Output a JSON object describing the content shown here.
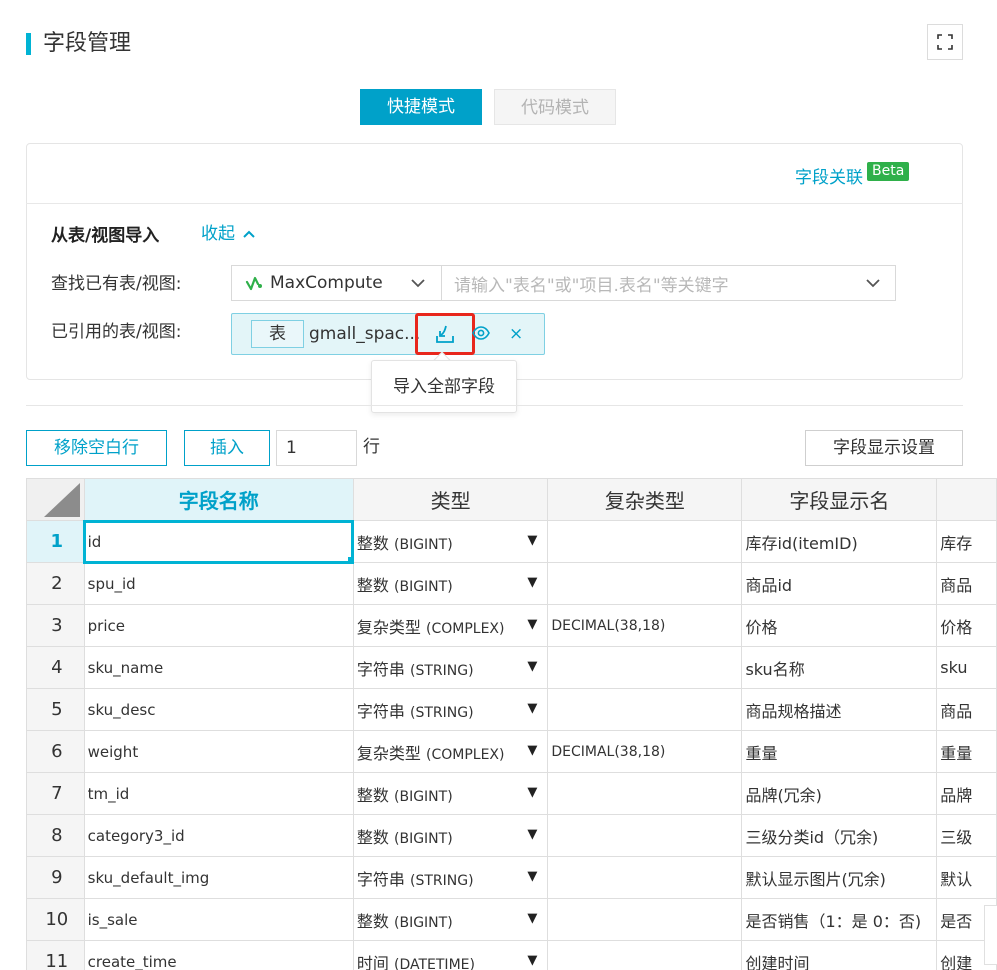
{
  "header": {
    "title": "字段管理"
  },
  "modes": {
    "quick": "快捷模式",
    "code": "代码模式"
  },
  "import_panel": {
    "relation_link": "字段关联",
    "beta": "Beta",
    "section_title": "从表/视图导入",
    "collapse_label": "收起",
    "find_label": "查找已有表/视图:",
    "source": "MaxCompute",
    "search_placeholder": "请输入\"表名\"或\"项目.表名\"等关键字",
    "ref_label": "已引用的表/视图:",
    "chip_tag": "表",
    "chip_name": "gmall_spac...",
    "chip_close": "×",
    "tooltip": "导入全部字段"
  },
  "toolbar": {
    "remove_blank": "移除空白行",
    "insert": "插入",
    "row_count": "1",
    "row_unit": "行",
    "display_settings": "字段显示设置"
  },
  "grid": {
    "columns": [
      "字段名称",
      "类型",
      "复杂类型",
      "字段显示名"
    ],
    "rows": [
      {
        "num": "1",
        "name": "id",
        "type_cn": "整数",
        "type_en": "(BIGINT)",
        "complex": "",
        "display": "库存id(itemID)",
        "extra": "库存"
      },
      {
        "num": "2",
        "name": "spu_id",
        "type_cn": "整数",
        "type_en": "(BIGINT)",
        "complex": "",
        "display": "商品id",
        "extra": "商品"
      },
      {
        "num": "3",
        "name": "price",
        "type_cn": "复杂类型",
        "type_en": "(COMPLEX)",
        "complex": "DECIMAL(38,18)",
        "display": "价格",
        "extra": "价格"
      },
      {
        "num": "4",
        "name": "sku_name",
        "type_cn": "字符串",
        "type_en": "(STRING)",
        "complex": "",
        "display": "sku名称",
        "extra": "sku"
      },
      {
        "num": "5",
        "name": "sku_desc",
        "type_cn": "字符串",
        "type_en": "(STRING)",
        "complex": "",
        "display": "商品规格描述",
        "extra": "商品"
      },
      {
        "num": "6",
        "name": "weight",
        "type_cn": "复杂类型",
        "type_en": "(COMPLEX)",
        "complex": "DECIMAL(38,18)",
        "display": "重量",
        "extra": "重量"
      },
      {
        "num": "7",
        "name": "tm_id",
        "type_cn": "整数",
        "type_en": "(BIGINT)",
        "complex": "",
        "display": "品牌(冗余)",
        "extra": "品牌"
      },
      {
        "num": "8",
        "name": "category3_id",
        "type_cn": "整数",
        "type_en": "(BIGINT)",
        "complex": "",
        "display": "三级分类id（冗余)",
        "extra": "三级"
      },
      {
        "num": "9",
        "name": "sku_default_img",
        "type_cn": "字符串",
        "type_en": "(STRING)",
        "complex": "",
        "display": "默认显示图片(冗余)",
        "extra": "默认"
      },
      {
        "num": "10",
        "name": "is_sale",
        "type_cn": "整数",
        "type_en": "(BIGINT)",
        "complex": "",
        "display": "是否销售（1：是 0：否)",
        "extra": "是否"
      },
      {
        "num": "11",
        "name": "create_time",
        "type_cn": "时间",
        "type_en": "(DATETIME)",
        "complex": "",
        "display": "创建时间",
        "extra": "创建"
      }
    ]
  },
  "colors": {
    "accent": "#00a1c9",
    "highlight_border": "#e8261c",
    "beta_green": "#2fb04a"
  },
  "icons": [
    "fullscreen-icon",
    "chevron-up-icon",
    "maxcompute-icon",
    "chevron-down-icon",
    "import-fields-icon",
    "eye-icon",
    "close-icon",
    "dropdown-caret-icon"
  ]
}
